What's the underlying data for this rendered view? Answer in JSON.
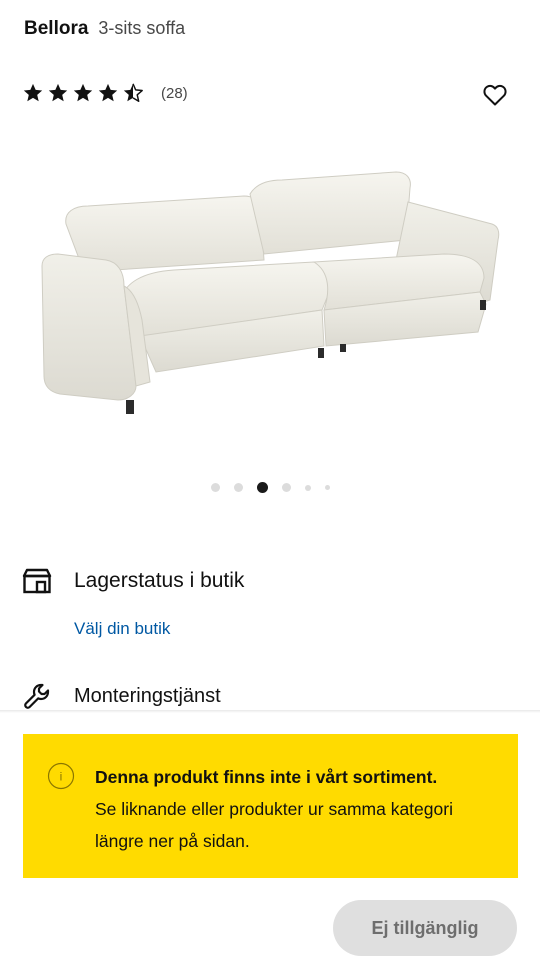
{
  "product": {
    "name": "Bellora",
    "description": "3-sits soffa",
    "rating": 4.5,
    "rating_max": 5,
    "review_count": "(28)"
  },
  "gallery": {
    "image_count": 6,
    "active_index": 2
  },
  "availability": {
    "store_label": "Lagerstatus i butik",
    "choose_store_link": "Välj din butik",
    "assembly_label": "Monteringstjänst"
  },
  "notice": {
    "icon_text": "i",
    "title": "Denna produkt finns inte i vårt sortiment.",
    "body": "Se liknande eller produkter ur samma kategori längre ner på sidan."
  },
  "action": {
    "button_label": "Ej tillgänglig"
  },
  "colors": {
    "notice_bg": "#ffdb00",
    "link": "#0058a3",
    "disabled_button": "#dfdfdf"
  },
  "icons": [
    "star-icon",
    "heart-icon",
    "store-icon",
    "wrench-icon",
    "info-icon"
  ]
}
